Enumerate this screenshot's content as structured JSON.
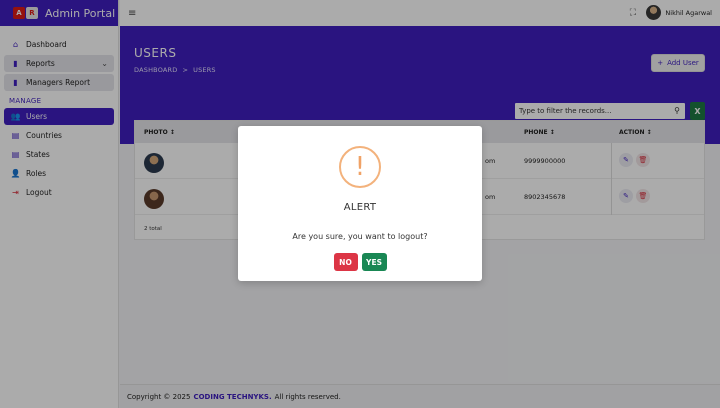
{
  "app": {
    "title": "Admin Portal",
    "logo_left": "A",
    "logo_right": "R"
  },
  "sidebar": {
    "items": [
      {
        "label": "Dashboard",
        "icon": "home-icon"
      },
      {
        "label": "Reports",
        "icon": "bar-chart-icon"
      },
      {
        "label": "Managers Report",
        "icon": "bar-chart-icon"
      }
    ],
    "section_label": "MANAGE",
    "manage_items": [
      {
        "label": "Users",
        "icon": "users-icon"
      },
      {
        "label": "Countries",
        "icon": "building-icon"
      },
      {
        "label": "States",
        "icon": "building-icon"
      },
      {
        "label": "Roles",
        "icon": "user-roles-icon"
      },
      {
        "label": "Logout",
        "icon": "logout-icon"
      }
    ]
  },
  "topbar": {
    "user_name": "Nikhil Agarwal"
  },
  "page": {
    "title": "USERS",
    "breadcrumb": [
      "DASHBOARD",
      ">",
      "USERS"
    ],
    "add_button": "Add User",
    "filter_placeholder": "Type to filter the records...",
    "excel_label": "X"
  },
  "table": {
    "headers": {
      "photo": "PHOTO",
      "phone": "PHONE",
      "action": "ACTION"
    },
    "sort_glyph": "↕",
    "rows": [
      {
        "email_tail": "om",
        "phone": "9999900000"
      },
      {
        "email_tail": "om",
        "phone": "8902345678"
      }
    ],
    "total": "2 total"
  },
  "footer": {
    "prefix": "Copyright © 2025",
    "brand": "CODING TECHNYKS.",
    "suffix": "All rights reserved."
  },
  "modal": {
    "icon": "!",
    "title": "ALERT",
    "message": "Are you sure, you want to logout?",
    "no": "NO",
    "yes": "YES"
  },
  "colors": {
    "primary": "#3f1fbf",
    "danger": "#dc3545",
    "success": "#198754",
    "warning": "#f3b27c"
  }
}
